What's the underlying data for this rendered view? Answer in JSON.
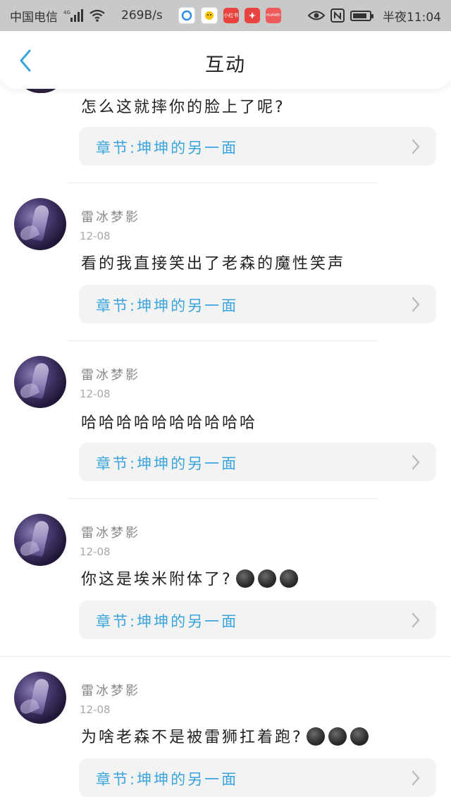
{
  "status_bar": {
    "carrier": "中国电信",
    "network": "4G",
    "speed": "269B/s",
    "time": "半夜11:04",
    "app_icons": [
      "browser-icon",
      "qq-browser-icon",
      "xiaohongshu-icon",
      "huawei-icon",
      "huawei-store-icon"
    ],
    "app_icon_texts": [
      "",
      "",
      "小红书",
      "",
      "HUAWEI"
    ]
  },
  "header": {
    "title": "互动"
  },
  "top_item": {
    "text": "怎么这就摔你的脸上了呢?",
    "chapter": "章节:坤坤的另一面"
  },
  "comments": [
    {
      "username": "雷冰梦影",
      "date": "12-08",
      "text": "看的我直接笑出了老森的魔性笑声",
      "emoji_count": 0,
      "chapter": "章节:坤坤的另一面"
    },
    {
      "username": "雷冰梦影",
      "date": "12-08",
      "text": "哈哈哈哈哈哈哈哈哈哈",
      "emoji_count": 0,
      "chapter": "章节:坤坤的另一面"
    },
    {
      "username": "雷冰梦影",
      "date": "12-08",
      "text": "你这是埃米附体了?",
      "emoji_count": 3,
      "chapter": "章节:坤坤的另一面"
    },
    {
      "username": "雷冰梦影",
      "date": "12-08",
      "text": "为啥老森不是被雷狮扛着跑?",
      "emoji_count": 3,
      "chapter": "章节:坤坤的另一面"
    }
  ],
  "colors": {
    "accent": "#3aa5dc",
    "status_bar_bg": "#c9c9c9",
    "card_bg": "#f3f3f3"
  }
}
